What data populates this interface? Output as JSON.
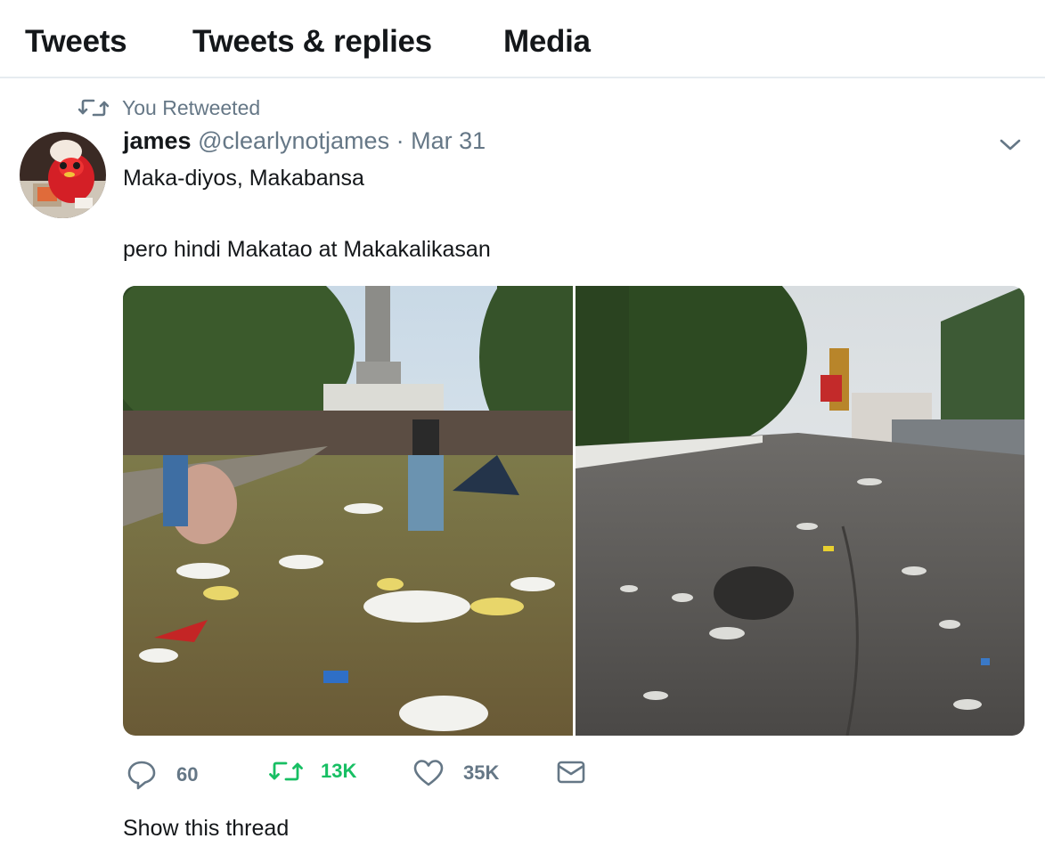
{
  "tabs": [
    {
      "label": "Tweets"
    },
    {
      "label": "Tweets & replies"
    },
    {
      "label": "Media"
    }
  ],
  "retweet_context": {
    "icon": "retweet-icon",
    "label": "You Retweeted"
  },
  "tweet": {
    "author_name": "james",
    "author_handle": "@clearlynotjames",
    "separator": "·",
    "date": "Mar 31",
    "text_line1": "Maka-diyos, Makabansa",
    "text_line2": "pero hindi Makatao at Makakalikasan",
    "avatar_icon": "avatar-mascot-photo",
    "more_icon": "chevron-down-icon",
    "media": [
      {
        "icon": "photo-church-grounds-litter"
      },
      {
        "icon": "photo-road-litter"
      }
    ]
  },
  "actions": {
    "reply": {
      "icon": "reply-icon",
      "count": "60"
    },
    "retweet": {
      "icon": "retweet-icon",
      "count": "13K",
      "color": "#17bf63"
    },
    "like": {
      "icon": "heart-icon",
      "count": "35K"
    },
    "dm": {
      "icon": "envelope-icon"
    }
  },
  "show_thread": "Show this thread",
  "colors": {
    "text": "#14171a",
    "muted": "#657786",
    "retweet": "#17bf63",
    "divider": "#e6ecf0"
  }
}
